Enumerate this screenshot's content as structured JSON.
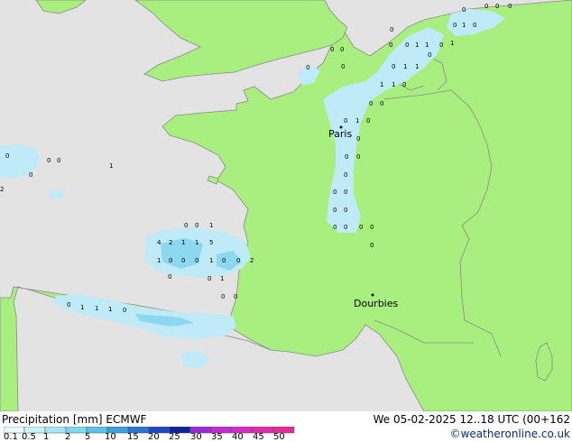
{
  "map": {
    "cities": [
      {
        "name": "Paris"
      },
      {
        "name": "Dourbies"
      }
    ],
    "precip_values": [
      "0",
      "0",
      "0",
      "0",
      "0",
      "0",
      "1",
      "1",
      "0",
      "0",
      "0",
      "0",
      "0",
      "0",
      "0",
      "0",
      "1",
      "1",
      "0",
      "0",
      "1",
      "1",
      "1",
      "1",
      "0",
      "0",
      "0",
      "0",
      "1",
      "0",
      "0",
      "0",
      "0",
      "0",
      "0",
      "0",
      "0",
      "0",
      "0",
      "0",
      "0",
      "0",
      "0",
      "0",
      "0",
      "0",
      "0",
      "1",
      "2",
      "0",
      "0",
      "1",
      "4",
      "2",
      "1",
      "1",
      "5",
      "1",
      "0",
      "0",
      "0",
      "1",
      "0",
      "0",
      "2",
      "0",
      "0",
      "1",
      "0",
      "0",
      "0",
      "1",
      "1",
      "1",
      "0"
    ],
    "colors": {
      "sea": "#e3e3e3",
      "land": "#a9ef7f",
      "border": "#8a8a8a",
      "precip_light": "#bfeaf7",
      "precip_mid": "#8bd8f0"
    }
  },
  "legend": {
    "title": "Precipitation [mm]  ECMWF",
    "scale_labels": [
      "0.1",
      "0.5",
      "1",
      "2",
      "5",
      "10",
      "15",
      "20",
      "25",
      "30",
      "35",
      "40",
      "45",
      "50"
    ],
    "colors": [
      "#e8fbff",
      "#c8f2fb",
      "#a4e6f6",
      "#7fd7f0",
      "#5cc2ea",
      "#3b9fe0",
      "#2a74d3",
      "#1d48c2",
      "#10229e",
      "#9a2ad6",
      "#c42ad4",
      "#d82ac8",
      "#e02ab0",
      "#e62a96"
    ]
  },
  "datetime": "We 05-02-2025 12..18 UTC (00+162",
  "credit": "©weatheronline.co.uk"
}
